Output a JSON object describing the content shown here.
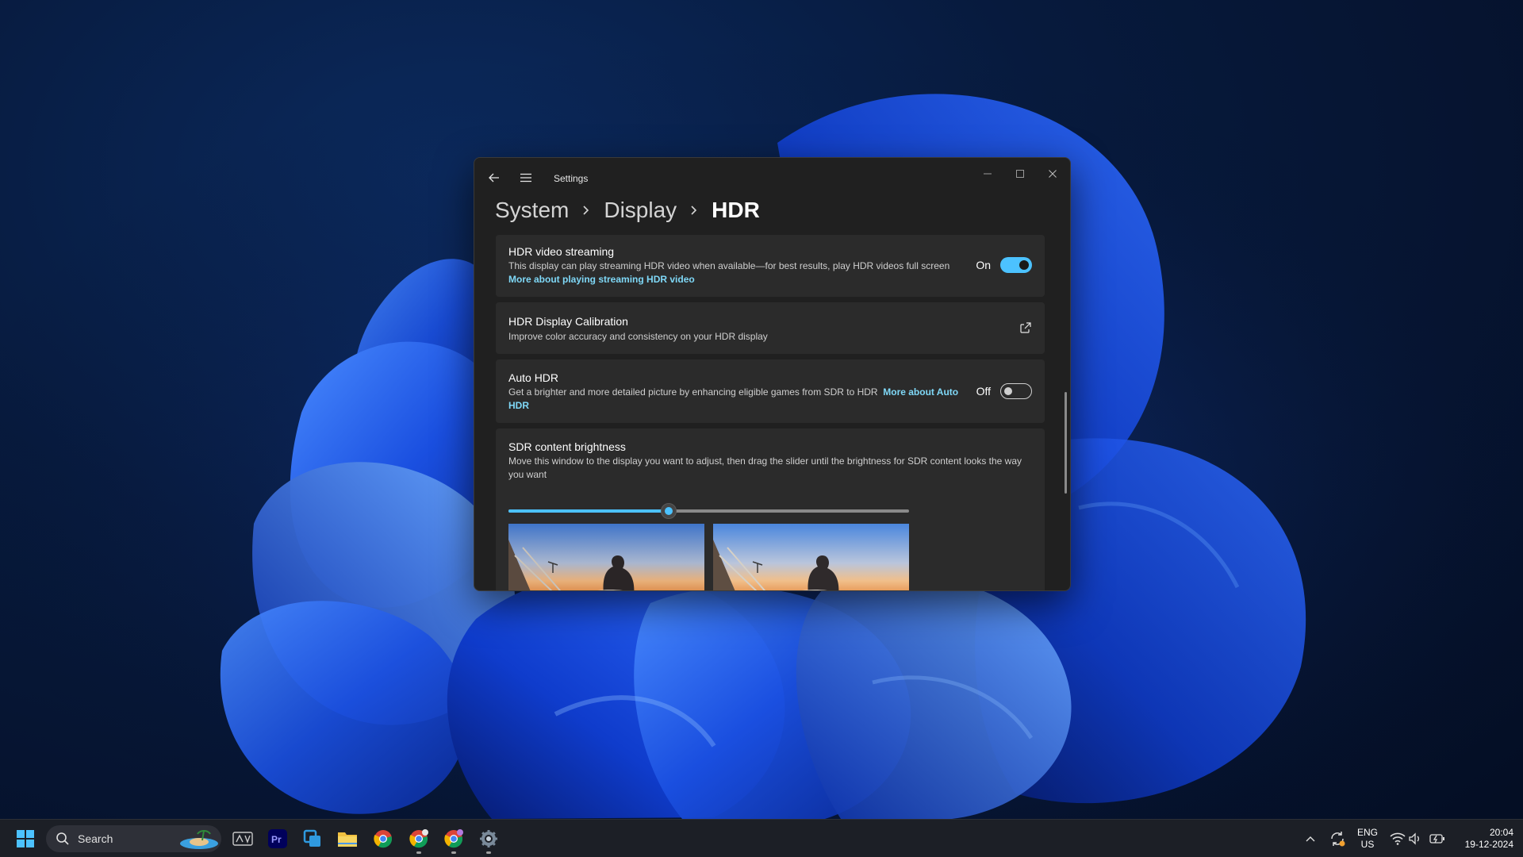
{
  "window": {
    "title": "Settings",
    "breadcrumb": [
      "System",
      "Display",
      "HDR"
    ]
  },
  "cards": {
    "hdr_streaming": {
      "title": "HDR video streaming",
      "description": "This display can play streaming HDR video when available—for best results, play HDR videos full screen",
      "link": "More about playing streaming HDR video",
      "toggle_label": "On",
      "toggle_on": true
    },
    "calibration": {
      "title": "HDR Display Calibration",
      "description": "Improve color accuracy and consistency on your HDR display",
      "icon": "open-external-icon"
    },
    "auto_hdr": {
      "title": "Auto HDR",
      "description": "Get a brighter and more detailed picture by enhancing eligible games from SDR to HDR",
      "link": "More about Auto HDR",
      "toggle_label": "Off",
      "toggle_on": false
    },
    "sdr_brightness": {
      "title": "SDR content brightness",
      "description": "Move this window to the display you want to adjust, then drag the slider until the brightness for SDR content looks the way you want",
      "slider_value": 0.4
    }
  },
  "taskbar": {
    "search_placeholder": "Search",
    "apps": [
      "start-icon",
      "search-icon",
      "widgets-icon",
      "premiere-pro-icon",
      "remote-desktop-icon",
      "file-explorer-icon",
      "chrome-icon",
      "chrome-profile-icon",
      "chrome-profile-2-icon",
      "settings-icon"
    ],
    "tray": {
      "language": "ENG",
      "region": "US",
      "time": "20:04",
      "date": "19-12-2024"
    }
  },
  "colors": {
    "accent": "#4cc2ff",
    "window_bg": "#202020",
    "card_bg": "#2b2b2b",
    "link": "#7fd8f7"
  }
}
